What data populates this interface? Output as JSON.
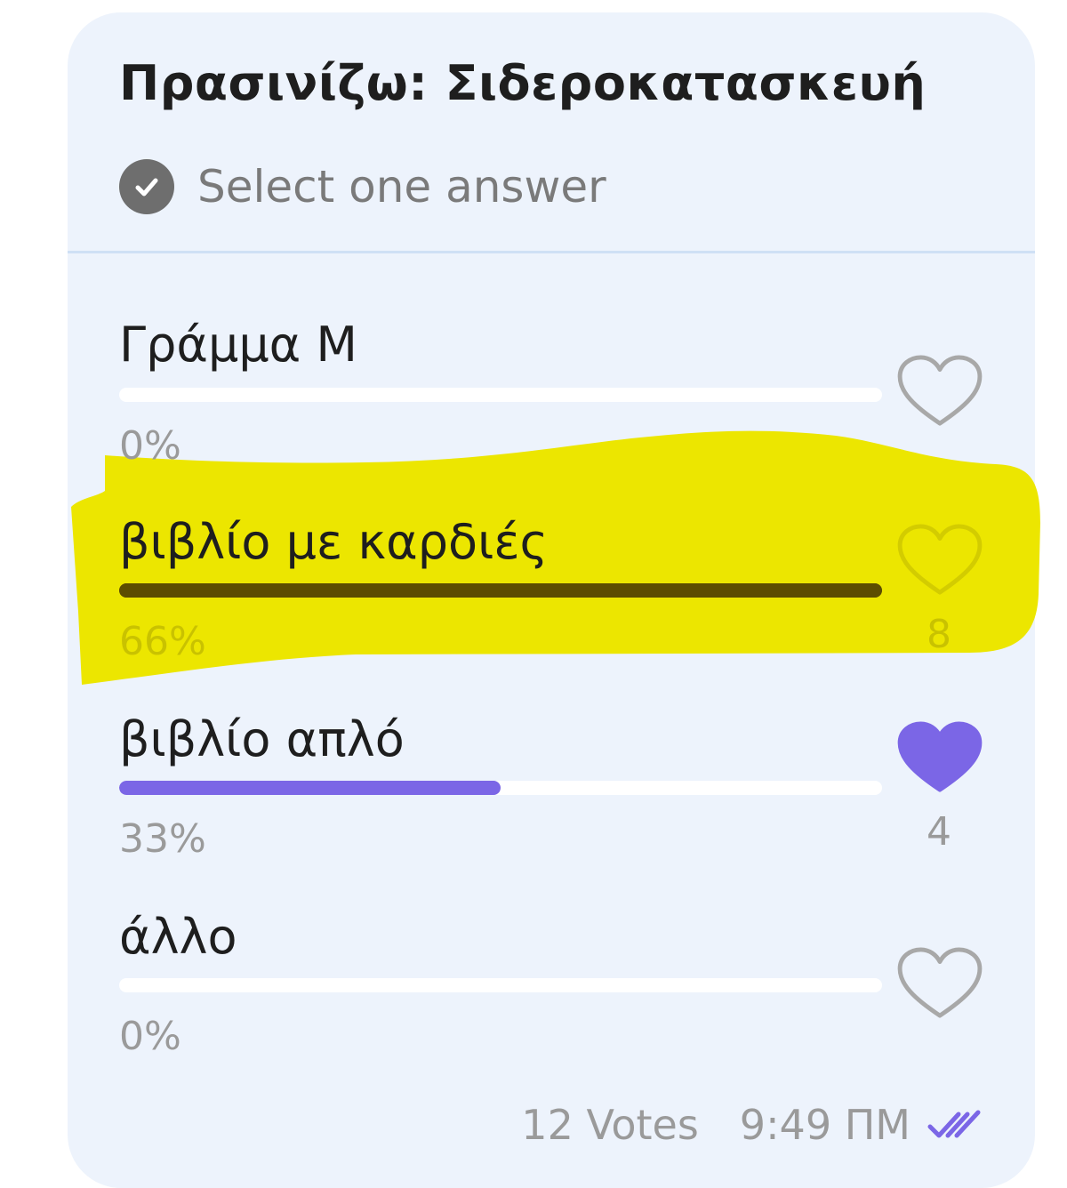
{
  "poll": {
    "title": "Πρασινίζω: Σιδεροκατασκευή",
    "subtitle": "Select one answer",
    "options": [
      {
        "label": "Γράμμα Μ",
        "percent": "0%",
        "fraction": 0,
        "count": "",
        "liked": false
      },
      {
        "label": "βιβλίο με καρδιές",
        "percent": "66%",
        "fraction": 1.0,
        "count": "8",
        "liked": false
      },
      {
        "label": "βιβλίο απλό",
        "percent": "33%",
        "fraction": 0.5,
        "count": "4",
        "liked": true
      },
      {
        "label": "άλλο",
        "percent": "0%",
        "fraction": 0,
        "count": "",
        "liked": false
      }
    ],
    "votes": "12 Votes",
    "time": "9:49 ΠΜ"
  },
  "colors": {
    "card_background": "#edf3fc",
    "accent": "#7b66e6",
    "highlight": "#ece600",
    "muted_text": "#9a9a9a"
  },
  "icons": {
    "subtitle": "check-circle-icon",
    "option": "heart-icon",
    "footer": "double-check-icon"
  }
}
